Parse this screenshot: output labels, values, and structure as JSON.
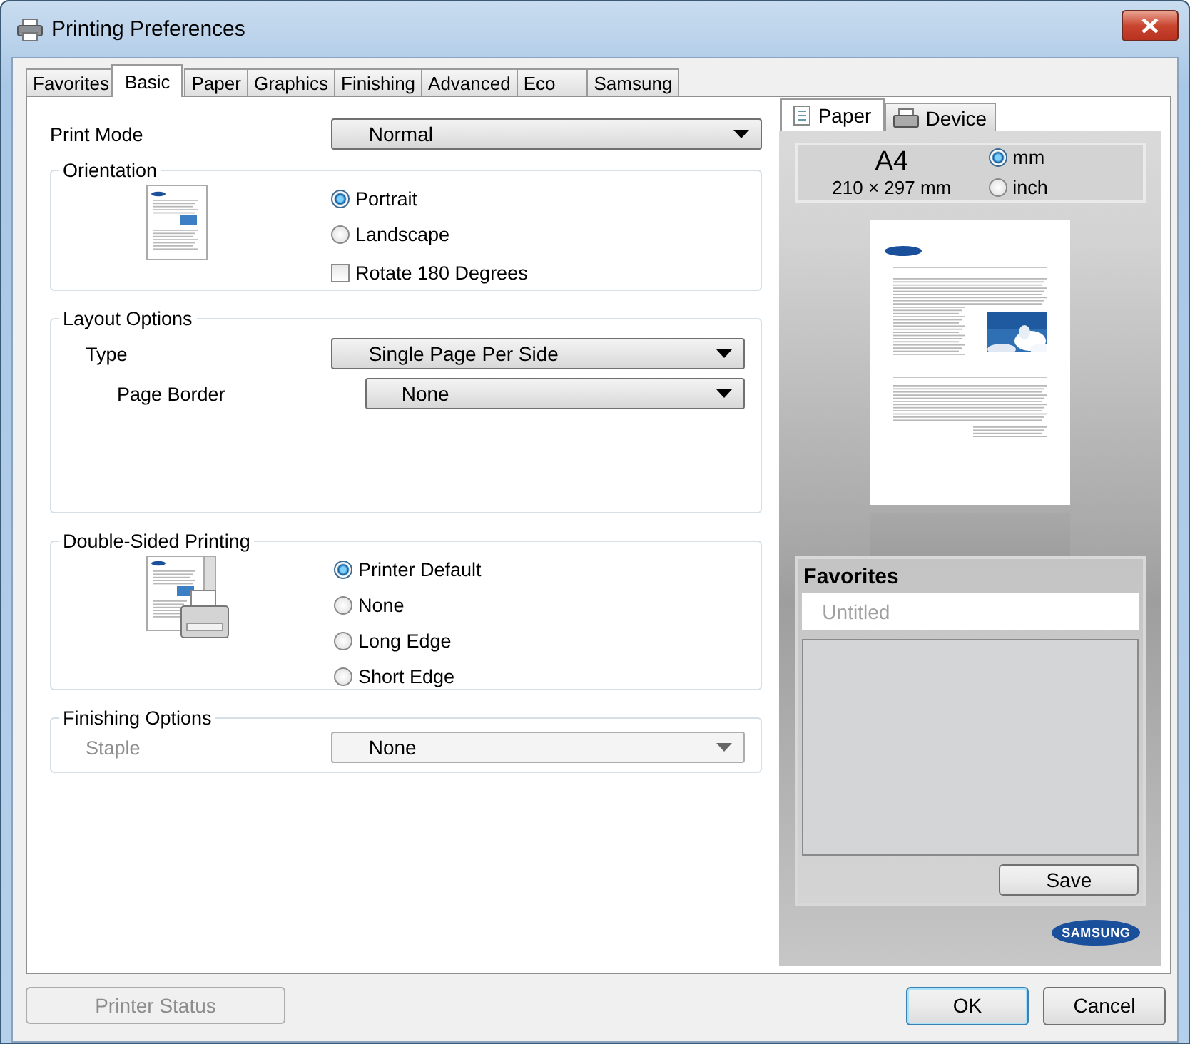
{
  "window": {
    "title": "Printing Preferences"
  },
  "tabs": [
    {
      "label": "Favorites",
      "selected": false
    },
    {
      "label": "Basic",
      "selected": true
    },
    {
      "label": "Paper",
      "selected": false
    },
    {
      "label": "Graphics",
      "selected": false
    },
    {
      "label": "Finishing",
      "selected": false
    },
    {
      "label": "Advanced",
      "selected": false
    },
    {
      "label": "Eco",
      "selected": false
    },
    {
      "label": "Samsung",
      "selected": false
    }
  ],
  "print_mode": {
    "label": "Print Mode",
    "value": "Normal"
  },
  "orientation": {
    "title": "Orientation",
    "options": [
      {
        "label": "Portrait",
        "selected": true
      },
      {
        "label": "Landscape",
        "selected": false
      }
    ],
    "rotate": {
      "label": "Rotate 180 Degrees",
      "checked": false
    }
  },
  "layout_options": {
    "title": "Layout Options",
    "type": {
      "label": "Type",
      "value": "Single Page Per Side"
    },
    "page_border": {
      "label": "Page Border",
      "value": "None"
    }
  },
  "double_sided": {
    "title": "Double-Sided Printing",
    "options": [
      {
        "label": "Printer Default",
        "selected": true
      },
      {
        "label": "None",
        "selected": false
      },
      {
        "label": "Long Edge",
        "selected": false
      },
      {
        "label": "Short Edge",
        "selected": false
      }
    ]
  },
  "finishing": {
    "title": "Finishing Options",
    "staple": {
      "label": "Staple",
      "value": "None",
      "disabled": true
    }
  },
  "preview": {
    "tabs": [
      {
        "label": "Paper",
        "selected": true
      },
      {
        "label": "Device",
        "selected": false
      }
    ],
    "paper_size": "A4",
    "dimensions": "210 × 297 mm",
    "units": [
      {
        "label": "mm",
        "selected": true
      },
      {
        "label": "inch",
        "selected": false
      }
    ]
  },
  "favorites": {
    "title": "Favorites",
    "placeholder": "Untitled",
    "save": "Save"
  },
  "logo": "SAMSUNG",
  "buttons": {
    "printer_status": {
      "label": "Printer Status",
      "disabled": true
    },
    "ok": "OK",
    "cancel": "Cancel"
  }
}
